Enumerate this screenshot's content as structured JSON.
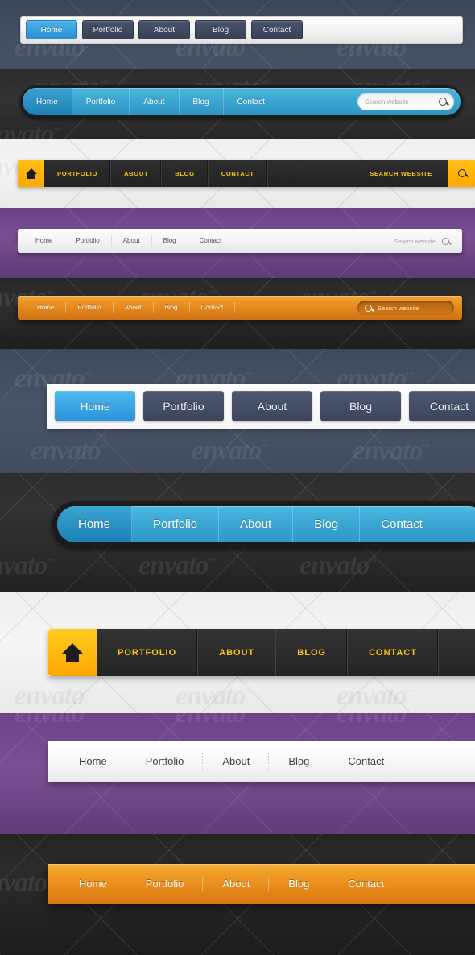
{
  "common": {
    "nav_labels": [
      "Home",
      "Portfolio",
      "About",
      "Blog",
      "Contact"
    ],
    "nav_labels_caps": [
      "PORTFOLIO",
      "ABOUT",
      "BLOG",
      "CONTACT"
    ],
    "search_placeholder": "Search website",
    "search_label_caps": "SEARCH WEBSITE",
    "watermark": "envato",
    "watermark_tm": "™"
  },
  "colors": {
    "accent_blue": "#3ba5d2",
    "accent_blue_light": "#4cb3ea",
    "dark_navy": "#3b4558",
    "yellow": "#ffc017",
    "orange": "#e4881d",
    "purple": "#7a4f93",
    "dark": "#2b2b2b",
    "light": "#f2f2f2",
    "nav_text_yellow": "#ffc517"
  },
  "bars": [
    {
      "id": "nav-buttons-light",
      "style": "White toolbar with small navy buttons on blue-grey background",
      "items": [
        "Home",
        "Portfolio",
        "About",
        "Blog",
        "Contact"
      ],
      "active": "Home",
      "has_search": false
    },
    {
      "id": "nav-pill-blue",
      "style": "Rounded blue pill bar on dark background",
      "items": [
        "Home",
        "Portfolio",
        "About",
        "Blog",
        "Contact"
      ],
      "active": "Home",
      "has_search": true,
      "search_placeholder": "Search website"
    },
    {
      "id": "nav-dark-yellow-home",
      "style": "Dark bar with yellow home tile on light background",
      "home_icon": "home-icon",
      "items": [
        "PORTFOLIO",
        "ABOUT",
        "BLOG",
        "CONTACT"
      ],
      "has_search": true,
      "search_label": "SEARCH WEBSITE"
    },
    {
      "id": "nav-white-purple",
      "style": "White bar on purple background",
      "items": [
        "Home",
        "Portfolio",
        "About",
        "Blog",
        "Contact"
      ],
      "has_search": true,
      "search_placeholder": "Search website"
    },
    {
      "id": "nav-orange-dark",
      "style": "Orange bar with inset search on dark background",
      "items": [
        "Home",
        "Portfolio",
        "About",
        "Blog",
        "Contact"
      ],
      "has_search": true,
      "search_placeholder": "Search website"
    },
    {
      "id": "nav-big-buttons",
      "style": "White toolbar with large navy buttons on blue-grey background",
      "items": [
        "Home",
        "Portfolio",
        "About",
        "Blog",
        "Contact"
      ],
      "active": "Home",
      "has_search": false
    },
    {
      "id": "nav-big-pill-blue",
      "style": "Large rounded blue pill bar on dark background",
      "items": [
        "Home",
        "Portfolio",
        "About",
        "Blog",
        "Contact"
      ],
      "active": "Home",
      "has_search": false
    },
    {
      "id": "nav-big-dark-yellow-home",
      "style": "Large dark bar with yellow home tile on light background",
      "home_icon": "home-icon",
      "items": [
        "PORTFOLIO",
        "ABOUT",
        "BLOG",
        "CONTACT"
      ],
      "has_search": false
    },
    {
      "id": "nav-big-white-purple",
      "style": "Large white bar with dotted separators on purple background",
      "items": [
        "Home",
        "Portfolio",
        "About",
        "Blog",
        "Contact"
      ],
      "has_search": false
    },
    {
      "id": "nav-big-orange-dark",
      "style": "Large orange bar on dark background",
      "items": [
        "Home",
        "Portfolio",
        "About",
        "Blog",
        "Contact"
      ],
      "has_search": false
    }
  ]
}
